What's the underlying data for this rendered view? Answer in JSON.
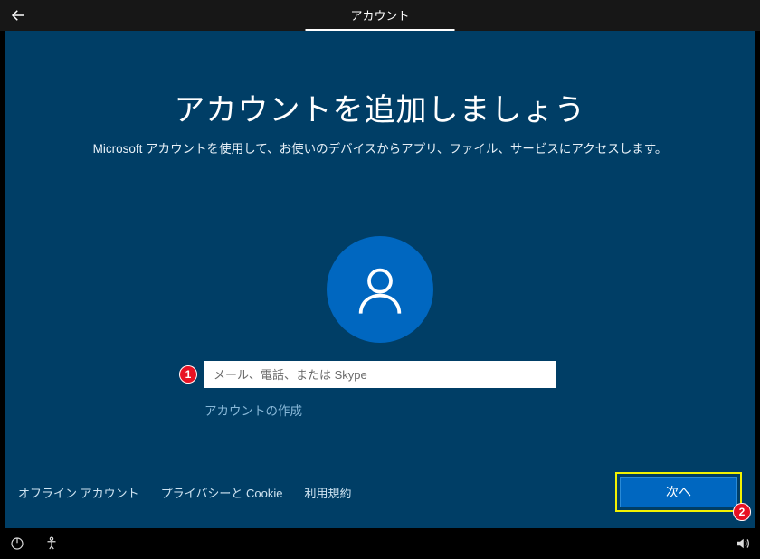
{
  "header": {
    "tab_label": "アカウント"
  },
  "main": {
    "title": "アカウントを追加しましょう",
    "subtitle": "Microsoft アカウントを使用して、お使いのデバイスからアプリ、ファイル、サービスにアクセスします。",
    "email_placeholder": "メール、電話、または Skype",
    "create_account_label": "アカウントの作成"
  },
  "footer_links": {
    "offline": "オフライン アカウント",
    "privacy": "プライバシーと Cookie",
    "terms": "利用規約"
  },
  "buttons": {
    "next": "次へ"
  },
  "annotations": {
    "badge1": "1",
    "badge2": "2"
  }
}
